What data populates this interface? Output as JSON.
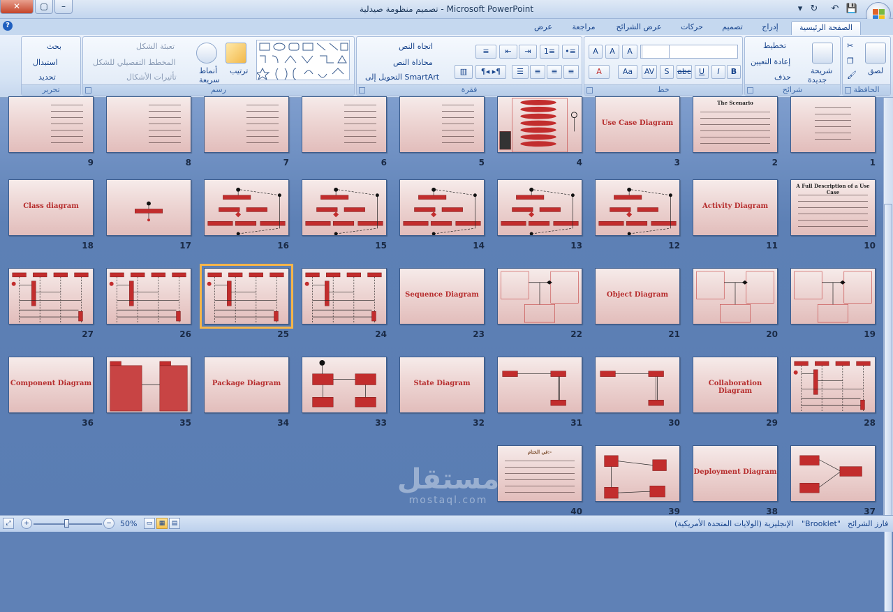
{
  "window": {
    "title": "تصميم منظومة صيدلية - Microsoft PowerPoint"
  },
  "tabs": [
    "الصفحة الرئيسية",
    "إدراج",
    "تصميم",
    "حركات",
    "عرض الشرائح",
    "مراجعة",
    "عرض"
  ],
  "ribbon": {
    "clipboard": {
      "label": "الحافظة",
      "paste": "لصق"
    },
    "slides": {
      "label": "شرائح",
      "new_slide": "شريحة",
      "new_slide2": "جديدة",
      "layout": "تخطيط",
      "reset": "إعادة التعيين",
      "delete": "حذف"
    },
    "font": {
      "label": "خط"
    },
    "paragraph": {
      "label": "فقرة",
      "text_direction": "اتجاه النص",
      "align_text": "محاذاة النص",
      "smartart": "التحويل إلى SmartArt"
    },
    "drawing": {
      "label": "رسم",
      "arrange": "ترتيب",
      "quick_styles": "أنماط",
      "quick_styles2": "سريعة",
      "fill": "تعبئة الشكل",
      "outline": "المخطط التفصيلي للشكل",
      "effects": "تأثيرات الأشكال"
    },
    "editing": {
      "label": "تحرير",
      "find": "بحث",
      "replace": "استبدال",
      "select": "تحديد"
    }
  },
  "slides": [
    {
      "n": "1",
      "kind": "title-lines"
    },
    {
      "n": "2",
      "kind": "text",
      "t": "The Scenario"
    },
    {
      "n": "3",
      "kind": "title",
      "t": "Use Case Diagram"
    },
    {
      "n": "4",
      "kind": "usecase"
    },
    {
      "n": "5",
      "kind": "bullets"
    },
    {
      "n": "6",
      "kind": "bullets"
    },
    {
      "n": "7",
      "kind": "bullets"
    },
    {
      "n": "8",
      "kind": "bullets"
    },
    {
      "n": "9",
      "kind": "bullets"
    },
    {
      "n": "10",
      "kind": "text",
      "t": "A Full Description of a Use Case"
    },
    {
      "n": "11",
      "kind": "title",
      "t": "Activity Diagram"
    },
    {
      "n": "12",
      "kind": "activity"
    },
    {
      "n": "13",
      "kind": "activity"
    },
    {
      "n": "14",
      "kind": "activity"
    },
    {
      "n": "15",
      "kind": "activity"
    },
    {
      "n": "16",
      "kind": "activity"
    },
    {
      "n": "17",
      "kind": "small"
    },
    {
      "n": "18",
      "kind": "title",
      "t": "Class diagram"
    },
    {
      "n": "19",
      "kind": "class"
    },
    {
      "n": "20",
      "kind": "class"
    },
    {
      "n": "21",
      "kind": "title",
      "t": "Object Diagram"
    },
    {
      "n": "22",
      "kind": "class"
    },
    {
      "n": "23",
      "kind": "title",
      "t": "Sequence Diagram"
    },
    {
      "n": "24",
      "kind": "sequence"
    },
    {
      "n": "25",
      "kind": "sequence",
      "selected": true
    },
    {
      "n": "26",
      "kind": "sequence"
    },
    {
      "n": "27",
      "kind": "sequence"
    },
    {
      "n": "28",
      "kind": "sequence"
    },
    {
      "n": "29",
      "kind": "title",
      "t": "Collaboration Diagram"
    },
    {
      "n": "30",
      "kind": "collab"
    },
    {
      "n": "31",
      "kind": "collab"
    },
    {
      "n": "32",
      "kind": "title",
      "t": "State  Diagram"
    },
    {
      "n": "33",
      "kind": "state"
    },
    {
      "n": "34",
      "kind": "title",
      "t": "Package Diagram"
    },
    {
      "n": "35",
      "kind": "package"
    },
    {
      "n": "36",
      "kind": "title",
      "t": "Component Diagram"
    },
    {
      "n": "37",
      "kind": "component"
    },
    {
      "n": "38",
      "kind": "title",
      "t": "Deployment Diagram"
    },
    {
      "n": "39",
      "kind": "deploy"
    },
    {
      "n": "40",
      "kind": "end",
      "t": "في الختام:-"
    }
  ],
  "status": {
    "slide_sorter": "فارز الشرائح",
    "theme": "\"Brooklet\"",
    "language": "الإنجليزية (الولايات المتحدة الأمريكية)",
    "zoom": "50%"
  },
  "watermark": {
    "arabic": "مستقل",
    "latin": "mostaql.com"
  },
  "colors": {
    "accent": "#c02a2a",
    "selection": "#f5b54a"
  }
}
